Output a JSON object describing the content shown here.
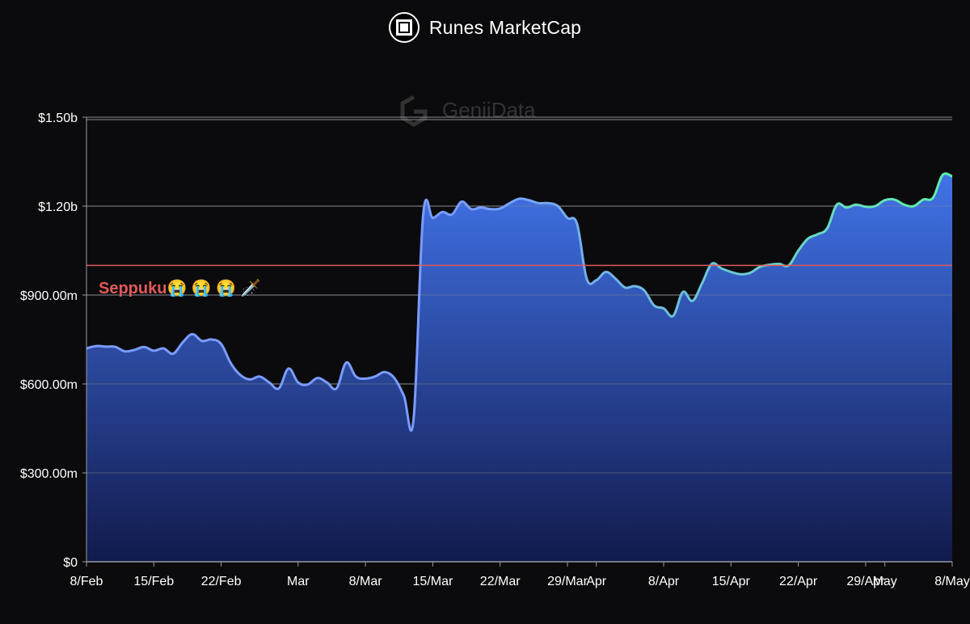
{
  "header": {
    "title": "Runes MarketCap",
    "logo_icon": "square-logo-icon"
  },
  "watermark": "GeniiData",
  "chart_data": {
    "type": "area",
    "title": "Runes MarketCap",
    "xlabel": "",
    "ylabel": "",
    "ylim": [
      0,
      1500000000
    ],
    "x_range": [
      "2024-02-08",
      "2024-05-08"
    ],
    "y_ticks": [
      {
        "value": 0,
        "label": "$0"
      },
      {
        "value": 300000000,
        "label": "$300.00m"
      },
      {
        "value": 600000000,
        "label": "$600.00m"
      },
      {
        "value": 900000000,
        "label": "$900.00m"
      },
      {
        "value": 1200000000,
        "label": "$1.20b"
      },
      {
        "value": 1500000000,
        "label": "$1.50b"
      }
    ],
    "x_ticks": [
      {
        "date": "2024-02-08",
        "label": "8/Feb"
      },
      {
        "date": "2024-02-15",
        "label": "15/Feb"
      },
      {
        "date": "2024-02-22",
        "label": "22/Feb"
      },
      {
        "date": "2024-03-01",
        "label": "Mar"
      },
      {
        "date": "2024-03-08",
        "label": "8/Mar"
      },
      {
        "date": "2024-03-15",
        "label": "15/Mar"
      },
      {
        "date": "2024-03-22",
        "label": "22/Mar"
      },
      {
        "date": "2024-03-29",
        "label": "29/Mar"
      },
      {
        "date": "2024-04-01",
        "label": "Apr"
      },
      {
        "date": "2024-04-08",
        "label": "8/Apr"
      },
      {
        "date": "2024-04-15",
        "label": "15/Apr"
      },
      {
        "date": "2024-04-22",
        "label": "22/Apr"
      },
      {
        "date": "2024-04-29",
        "label": "29/Apr"
      },
      {
        "date": "2024-05-01",
        "label": "May"
      },
      {
        "date": "2024-05-08",
        "label": "8/May"
      }
    ],
    "grid": true,
    "reference_line": {
      "value": 1000000000,
      "color": "#e05a5a",
      "label": "Seppuku😭 😭 😭 🗡️"
    },
    "series": [
      {
        "name": "",
        "points": [
          [
            "2024-02-08",
            720000000
          ],
          [
            "2024-02-09",
            728000000
          ],
          [
            "2024-02-10",
            726000000
          ],
          [
            "2024-02-11",
            725000000
          ],
          [
            "2024-02-12",
            710000000
          ],
          [
            "2024-02-13",
            715000000
          ],
          [
            "2024-02-14",
            725000000
          ],
          [
            "2024-02-15",
            712000000
          ],
          [
            "2024-02-16",
            720000000
          ],
          [
            "2024-02-17",
            702000000
          ],
          [
            "2024-02-18",
            740000000
          ],
          [
            "2024-02-19",
            768000000
          ],
          [
            "2024-02-20",
            745000000
          ],
          [
            "2024-02-21",
            750000000
          ],
          [
            "2024-02-22",
            735000000
          ],
          [
            "2024-02-23",
            670000000
          ],
          [
            "2024-02-24",
            630000000
          ],
          [
            "2024-02-25",
            615000000
          ],
          [
            "2024-02-26",
            625000000
          ],
          [
            "2024-02-27",
            605000000
          ],
          [
            "2024-02-28",
            585000000
          ],
          [
            "2024-02-29",
            652000000
          ],
          [
            "2024-03-01",
            605000000
          ],
          [
            "2024-03-02",
            598000000
          ],
          [
            "2024-03-03",
            620000000
          ],
          [
            "2024-03-04",
            605000000
          ],
          [
            "2024-03-05",
            585000000
          ],
          [
            "2024-03-06",
            672000000
          ],
          [
            "2024-03-07",
            625000000
          ],
          [
            "2024-03-08",
            618000000
          ],
          [
            "2024-03-09",
            625000000
          ],
          [
            "2024-03-10",
            640000000
          ],
          [
            "2024-03-11",
            620000000
          ],
          [
            "2024-03-12",
            560000000
          ],
          [
            "2024-03-13",
            480000000
          ],
          [
            "2024-03-14",
            1170000000
          ],
          [
            "2024-03-15",
            1160000000
          ],
          [
            "2024-03-16",
            1180000000
          ],
          [
            "2024-03-17",
            1172000000
          ],
          [
            "2024-03-18",
            1215000000
          ],
          [
            "2024-03-19",
            1190000000
          ],
          [
            "2024-03-20",
            1195000000
          ],
          [
            "2024-03-21",
            1190000000
          ],
          [
            "2024-03-22",
            1192000000
          ],
          [
            "2024-03-23",
            1210000000
          ],
          [
            "2024-03-24",
            1225000000
          ],
          [
            "2024-03-25",
            1220000000
          ],
          [
            "2024-03-26",
            1210000000
          ],
          [
            "2024-03-27",
            1210000000
          ],
          [
            "2024-03-28",
            1200000000
          ],
          [
            "2024-03-29",
            1160000000
          ],
          [
            "2024-03-30",
            1140000000
          ],
          [
            "2024-03-31",
            955000000
          ],
          [
            "2024-04-01",
            950000000
          ],
          [
            "2024-04-02",
            978000000
          ],
          [
            "2024-04-03",
            955000000
          ],
          [
            "2024-04-04",
            925000000
          ],
          [
            "2024-04-05",
            930000000
          ],
          [
            "2024-04-06",
            915000000
          ],
          [
            "2024-04-07",
            865000000
          ],
          [
            "2024-04-08",
            855000000
          ],
          [
            "2024-04-09",
            830000000
          ],
          [
            "2024-04-10",
            910000000
          ],
          [
            "2024-04-11",
            880000000
          ],
          [
            "2024-04-12",
            940000000
          ],
          [
            "2024-04-13",
            1005000000
          ],
          [
            "2024-04-14",
            990000000
          ],
          [
            "2024-04-15",
            978000000
          ],
          [
            "2024-04-16",
            970000000
          ],
          [
            "2024-04-17",
            975000000
          ],
          [
            "2024-04-18",
            995000000
          ],
          [
            "2024-04-19",
            1002000000
          ],
          [
            "2024-04-20",
            1005000000
          ],
          [
            "2024-04-21",
            1000000000
          ],
          [
            "2024-04-22",
            1050000000
          ],
          [
            "2024-04-23",
            1090000000
          ],
          [
            "2024-04-24",
            1105000000
          ],
          [
            "2024-04-25",
            1125000000
          ],
          [
            "2024-04-26",
            1205000000
          ],
          [
            "2024-04-27",
            1195000000
          ],
          [
            "2024-04-28",
            1205000000
          ],
          [
            "2024-04-29",
            1198000000
          ],
          [
            "2024-04-30",
            1200000000
          ],
          [
            "2024-05-01",
            1220000000
          ],
          [
            "2024-05-02",
            1222000000
          ],
          [
            "2024-05-03",
            1205000000
          ],
          [
            "2024-05-04",
            1200000000
          ],
          [
            "2024-05-05",
            1222000000
          ],
          [
            "2024-05-06",
            1228000000
          ],
          [
            "2024-05-07",
            1305000000
          ],
          [
            "2024-05-08",
            1300000000
          ]
        ]
      }
    ],
    "colors": {
      "line_start": "#7a9cff",
      "line_end": "#5ef0a8",
      "fill_top": "#4173e8",
      "fill_bottom": "#121a4c",
      "grid": "#8e8e93",
      "axis": "#9a9aa0"
    }
  }
}
